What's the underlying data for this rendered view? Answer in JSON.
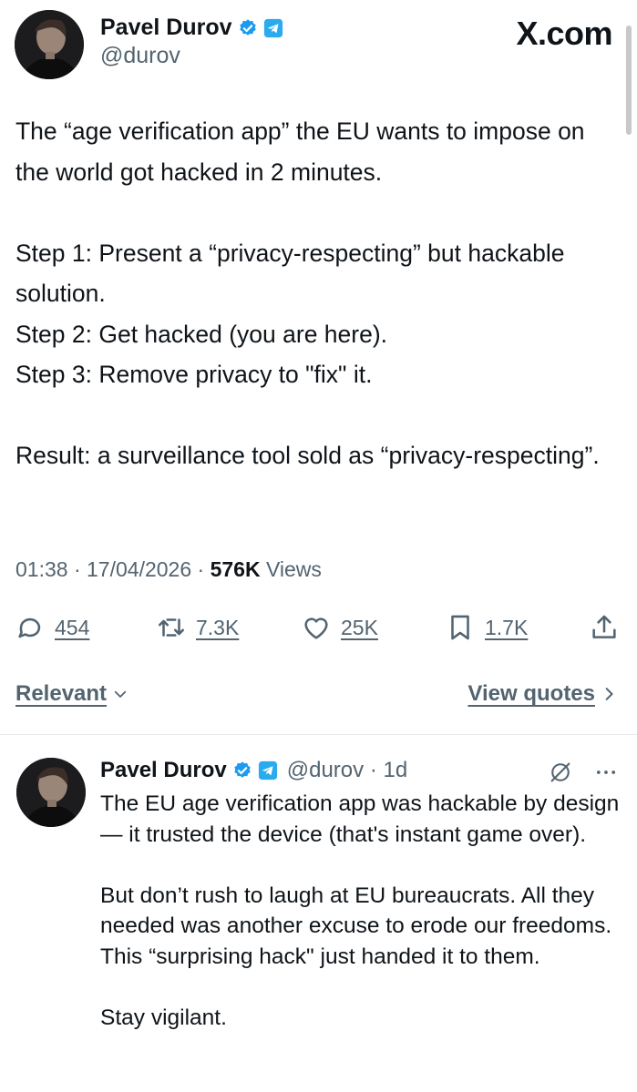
{
  "source_logo": "X.com",
  "tweet": {
    "author_name": "Pavel Durov",
    "handle": "@durov",
    "body": {
      "p1": "The “age verification app” the EU wants to impose on the world got hacked in 2 minutes.",
      "step1": "Step 1: Present a “privacy-respecting” but hackable solution.",
      "step2": "Step 2: Get hacked (you are here).",
      "step3": "Step 3: Remove privacy to \"fix\" it.",
      "result": "Result: a surveillance tool sold as “privacy-respecting”."
    },
    "time": "01:38",
    "date": "17/04/2026",
    "views_count": "576K",
    "views_label": "Views",
    "replies": "454",
    "reposts": "7.3K",
    "likes": "25K",
    "bookmarks": "1.7K"
  },
  "filters": {
    "sort_label": "Relevant",
    "quotes_label": "View quotes"
  },
  "reply": {
    "author_name": "Pavel Durov",
    "handle": "@durov",
    "time": "1d",
    "p1": "The EU age verification app was hackable by design — it trusted the device (that's instant game over).",
    "p2": "But don’t rush to laugh at EU bureaucrats. All they needed was another excuse to erode our freedoms. This “surprising hack\" just handed it to them.",
    "p3": "Stay vigilant."
  },
  "icons": {
    "verified": "verified-badge-icon",
    "telegram": "telegram-icon",
    "reply": "reply-bubble-icon",
    "repost": "repost-icon",
    "like": "heart-icon",
    "bookmark": "bookmark-icon",
    "share": "share-icon",
    "grok": "grok-icon",
    "more": "more-icon"
  },
  "colors": {
    "verified_blue": "#1d9bf0",
    "telegram_blue": "#2aabee",
    "text": "#0f1419",
    "secondary_text": "#536471"
  }
}
